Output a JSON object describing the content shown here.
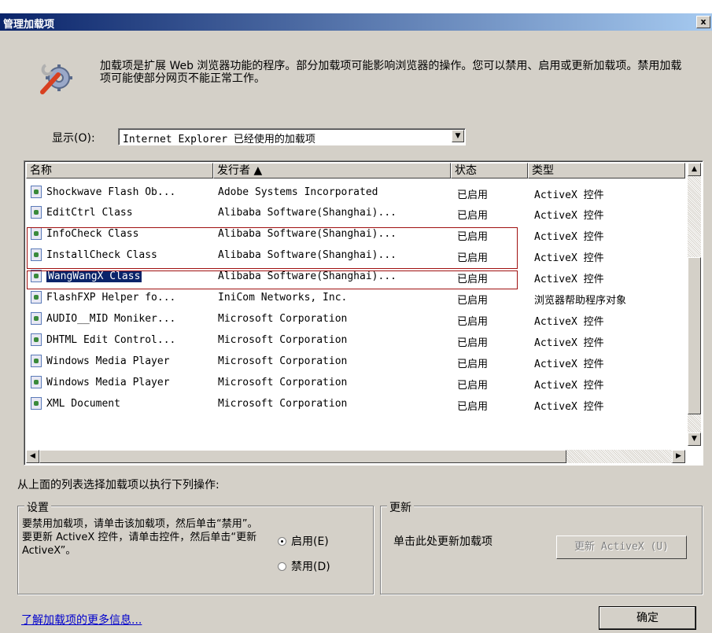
{
  "window": {
    "title": "管理加载项",
    "close_label": "x"
  },
  "description": "加载项是扩展 Web 浏览器功能的程序。部分加载项可能影响浏览器的操作。您可以禁用、启用或更新加载项。禁用加载项可能使部分网页不能正常工作。",
  "show": {
    "label": "显示(O):",
    "value": "Internet Explorer 已经使用的加载项"
  },
  "list": {
    "columns": [
      "名称",
      "发行者 ▲",
      "状态",
      "类型"
    ],
    "rows": [
      {
        "name": "Shockwave Flash Ob...",
        "publisher": "Adobe Systems Incorporated",
        "status": "已启用",
        "type": "ActiveX 控件"
      },
      {
        "name": "EditCtrl Class",
        "publisher": "Alibaba Software(Shanghai)...",
        "status": "已启用",
        "type": "ActiveX 控件"
      },
      {
        "name": "InfoCheck Class",
        "publisher": "Alibaba Software(Shanghai)...",
        "status": "已启用",
        "type": "ActiveX 控件"
      },
      {
        "name": "InstallCheck Class",
        "publisher": "Alibaba Software(Shanghai)...",
        "status": "已启用",
        "type": "ActiveX 控件"
      },
      {
        "name": "WangWangX Class",
        "publisher": "Alibaba Software(Shanghai)...",
        "status": "已启用",
        "type": "ActiveX 控件"
      },
      {
        "name": "FlashFXP Helper fo...",
        "publisher": "IniCom Networks, Inc.",
        "status": "已启用",
        "type": "浏览器帮助程序对象"
      },
      {
        "name": "AUDIO__MID Moniker...",
        "publisher": "Microsoft Corporation",
        "status": "已启用",
        "type": "ActiveX 控件"
      },
      {
        "name": "DHTML Edit Control...",
        "publisher": "Microsoft Corporation",
        "status": "已启用",
        "type": "ActiveX 控件"
      },
      {
        "name": "Windows Media Player",
        "publisher": "Microsoft Corporation",
        "status": "已启用",
        "type": "ActiveX 控件"
      },
      {
        "name": "Windows Media Player",
        "publisher": "Microsoft Corporation",
        "status": "已启用",
        "type": "ActiveX 控件"
      },
      {
        "name": "XML Document",
        "publisher": "Microsoft Corporation",
        "status": "已启用",
        "type": "ActiveX 控件"
      }
    ],
    "selected_index": 4,
    "highlight_color": "#a01010",
    "selection_color": "#0a246a"
  },
  "action_label": "从上面的列表选择加载项以执行下列操作:",
  "settings": {
    "title": "设置",
    "text": "要禁用加载项，请单击该加载项，然后单击“禁用”。要更新 ActiveX 控件，请单击控件，然后单击“更新 ActiveX”。",
    "enable_label": "启用(E)",
    "disable_label": "禁用(D)",
    "selected": "enable"
  },
  "update": {
    "title": "更新",
    "text": "单击此处更新加载项",
    "button_label": "更新 ActiveX (U)"
  },
  "more_info_link": "了解加载项的更多信息...",
  "ok_label": "确定"
}
